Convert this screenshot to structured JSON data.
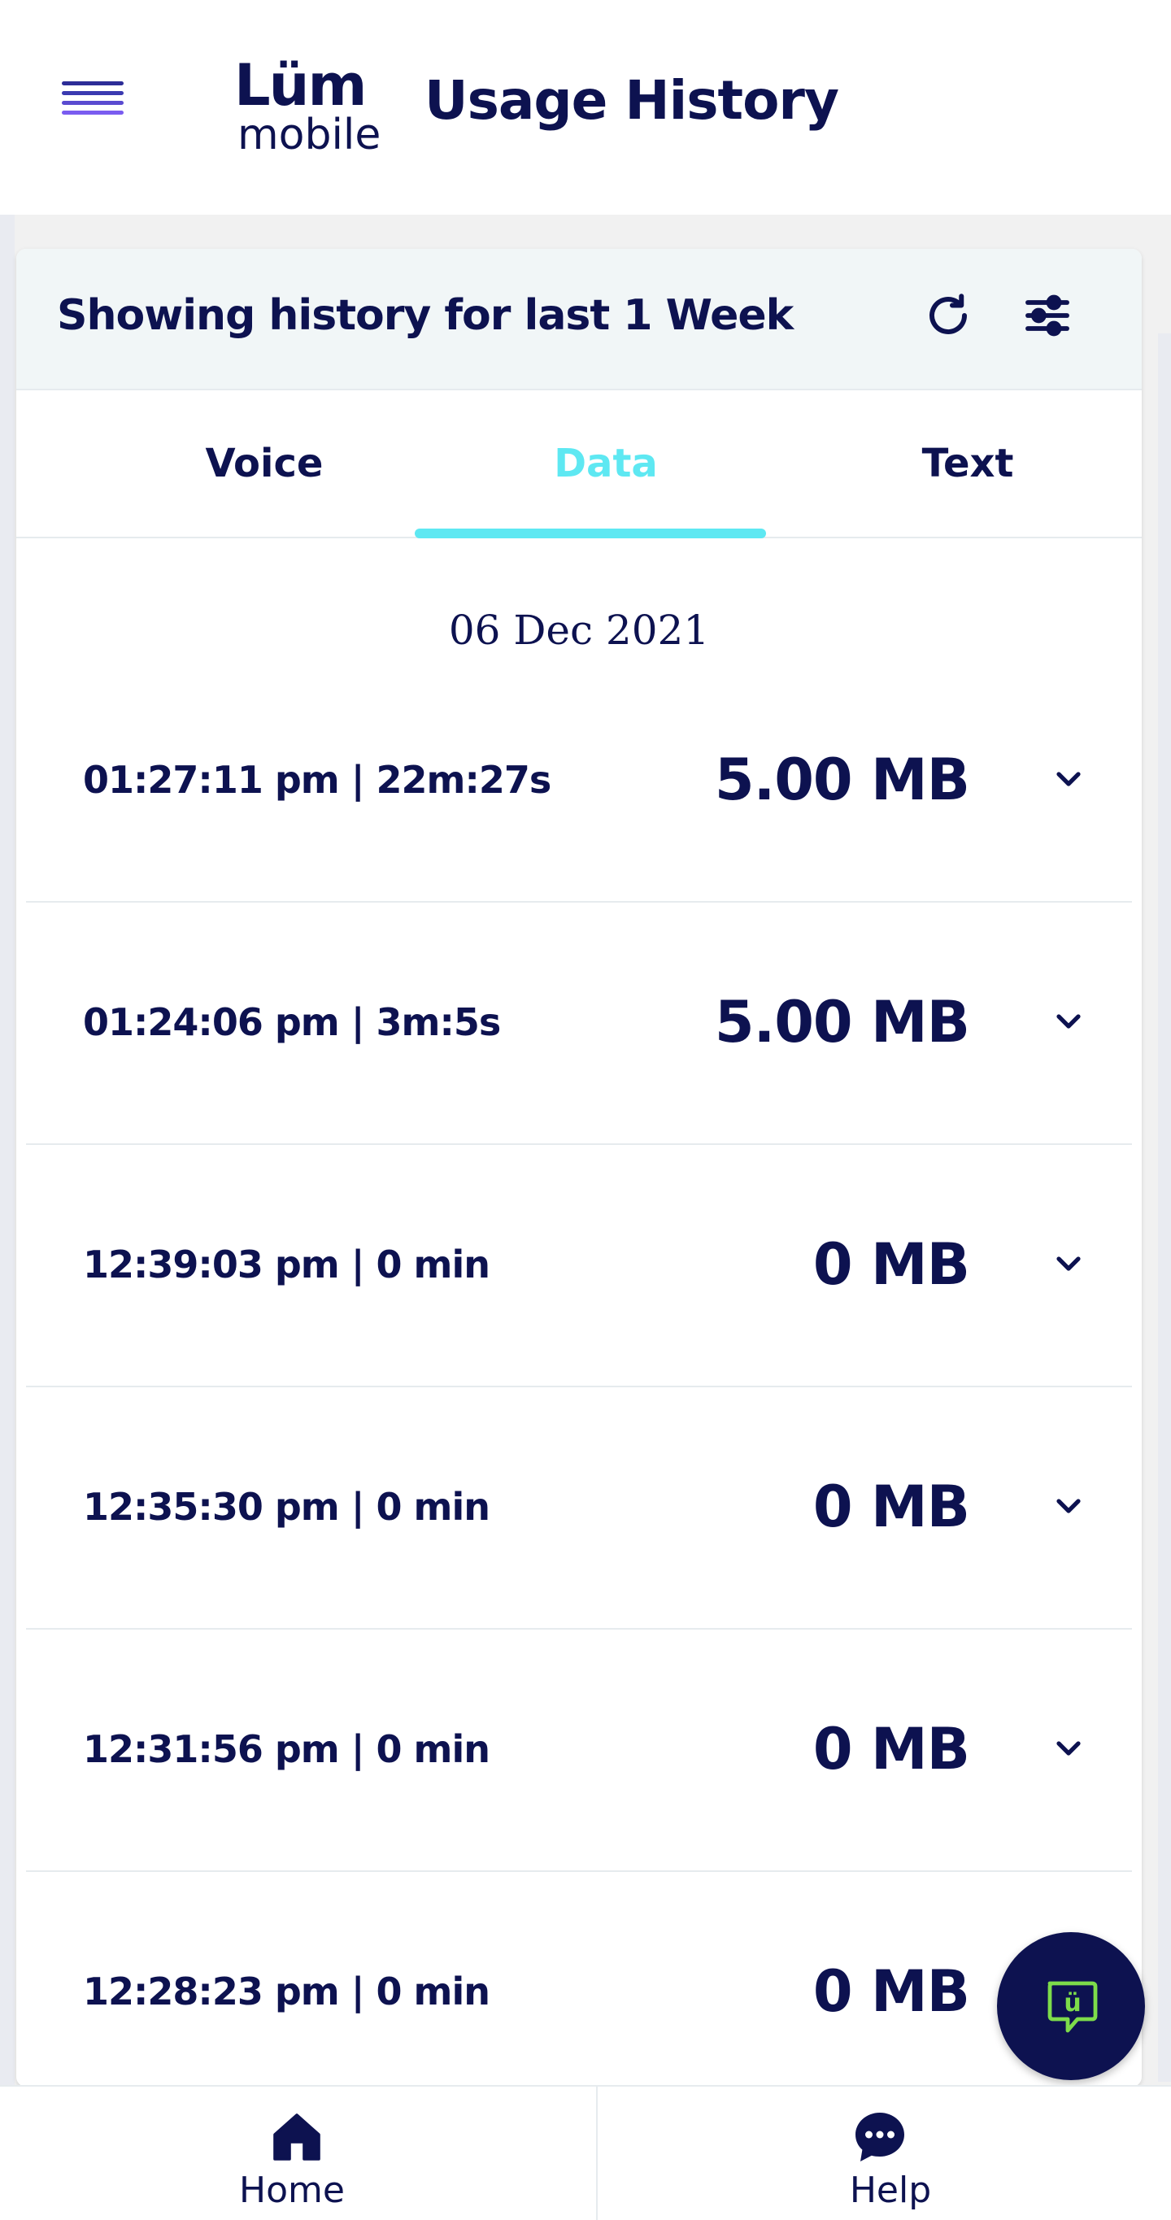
{
  "header": {
    "menu_icon": "hamburger-menu-icon",
    "logo": {
      "main": "Lüm",
      "sub": "mobile"
    },
    "title": "Usage History",
    "menu_colors": [
      "#2d2d97",
      "#3b3ab0",
      "#5a4bd0",
      "#7a5cf0"
    ]
  },
  "filter": {
    "text": "Showing history for last 1 Week",
    "refresh_icon": "refresh-icon",
    "filter_icon": "sliders-filter-icon"
  },
  "tabs": [
    {
      "label": "Voice",
      "active": false
    },
    {
      "label": "Data",
      "active": true
    },
    {
      "label": "Text",
      "active": false
    }
  ],
  "date": "06 Dec 2021",
  "records": [
    {
      "time": "01:27:11 pm | 22m:27s",
      "amount": "5.00 MB"
    },
    {
      "time": "01:24:06 pm | 3m:5s",
      "amount": "5.00 MB"
    },
    {
      "time": "12:39:03 pm | 0 min",
      "amount": "0 MB"
    },
    {
      "time": "12:35:30 pm | 0 min",
      "amount": "0 MB"
    },
    {
      "time": "12:31:56 pm | 0 min",
      "amount": "0 MB"
    },
    {
      "time": "12:28:23 pm | 0 min",
      "amount": "0 MB"
    }
  ],
  "chat": {
    "icon": "chat-bubble-icon",
    "glyph": "ü",
    "accent": "#7ddc4a"
  },
  "bottom_nav": [
    {
      "label": "Home",
      "icon": "home-icon"
    },
    {
      "label": "Help",
      "icon": "help-chat-icon"
    }
  ],
  "colors": {
    "navy": "#0d1250",
    "accent_cyan": "#5ee8f2"
  }
}
